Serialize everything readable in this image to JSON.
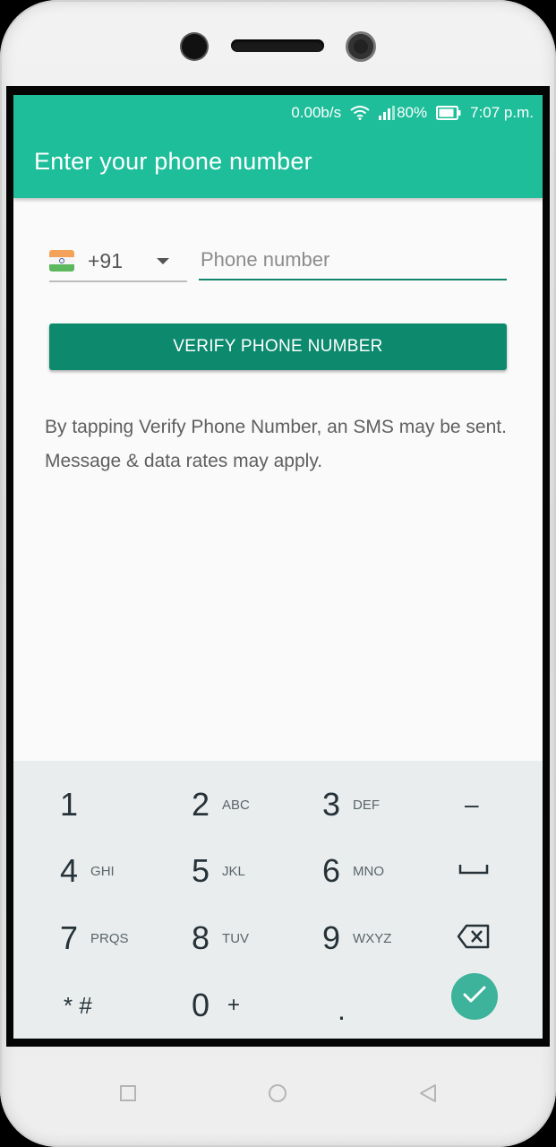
{
  "status_bar": {
    "network_speed": "0.00b/s",
    "battery_percent": "80%",
    "time": "7:07 p.m."
  },
  "app_bar": {
    "title": "Enter your phone number"
  },
  "form": {
    "country_code": "+91",
    "phone_placeholder": "Phone number",
    "verify_label": "VERIFY PHONE NUMBER",
    "disclaimer": "By tapping Verify Phone Number, an SMS may be sent. Message & data rates may apply."
  },
  "keypad": {
    "keys": [
      {
        "main": "1",
        "sub": ""
      },
      {
        "main": "2",
        "sub": "ABC"
      },
      {
        "main": "3",
        "sub": "DEF"
      },
      {
        "main": "–",
        "sub": ""
      },
      {
        "main": "4",
        "sub": "GHI"
      },
      {
        "main": "5",
        "sub": "JKL"
      },
      {
        "main": "6",
        "sub": "MNO"
      },
      {
        "main": "␣",
        "sub": ""
      },
      {
        "main": "7",
        "sub": "PRQS"
      },
      {
        "main": "8",
        "sub": "TUV"
      },
      {
        "main": "9",
        "sub": "WXYZ"
      },
      {
        "main": "⌫",
        "sub": ""
      },
      {
        "main": "* #",
        "sub": ""
      },
      {
        "main": "0",
        "sub": "+"
      },
      {
        "main": ".",
        "sub": ""
      },
      {
        "main": "✓",
        "sub": ""
      }
    ]
  },
  "colors": {
    "app_bar": "#1ebe9a",
    "button": "#0d8a6e",
    "input_underline": "#12866b",
    "done_button": "#3cb39a"
  },
  "icons": {
    "wifi": "wifi-icon",
    "signal": "signal-icon",
    "battery": "battery-icon",
    "flag": "india-flag-icon",
    "dropdown": "chevron-down-icon",
    "backspace": "backspace-icon",
    "done": "checkmark-icon",
    "nav_recents": "square-icon",
    "nav_home": "circle-icon",
    "nav_back": "triangle-back-icon"
  }
}
